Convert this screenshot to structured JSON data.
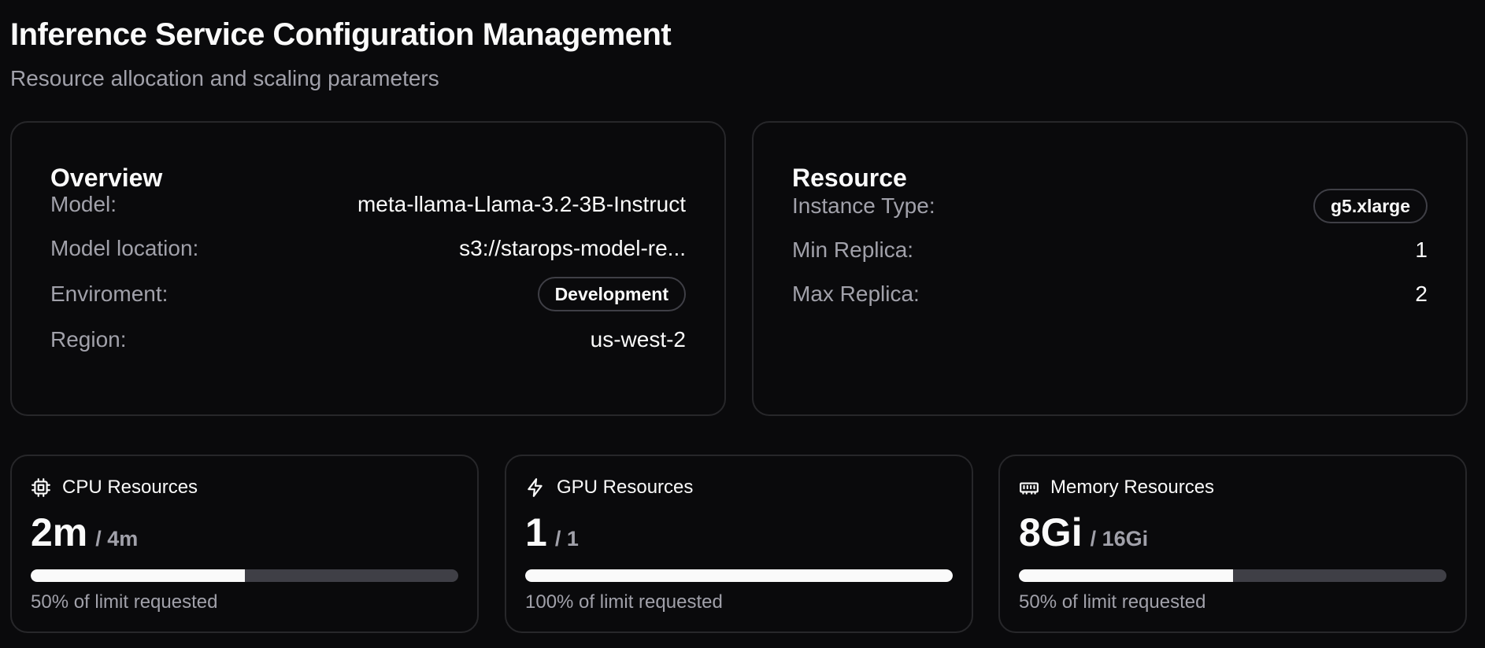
{
  "header": {
    "title": "Inference Service Configuration Management",
    "subtitle": "Resource allocation and scaling parameters"
  },
  "overview": {
    "title": "Overview",
    "rows": [
      {
        "label": "Model:",
        "value": "meta-llama-Llama-3.2-3B-Instruct"
      },
      {
        "label": "Model location:",
        "value": "s3://starops-model-re..."
      },
      {
        "label": "Enviroment:",
        "value": "Development"
      },
      {
        "label": "Region:",
        "value": "us-west-2"
      }
    ]
  },
  "resource": {
    "title": "Resource",
    "rows": [
      {
        "label": "Instance Type:",
        "value": "g5.xlarge"
      },
      {
        "label": "Min Replica:",
        "value": "1"
      },
      {
        "label": "Max Replica:",
        "value": "2"
      }
    ]
  },
  "stats": [
    {
      "label": "CPU Resources",
      "icon": "cpu-icon",
      "value": "2m",
      "limit": "/ 4m",
      "percent": 50,
      "note": "50% of limit requested"
    },
    {
      "label": "GPU Resources",
      "icon": "lightning-icon",
      "value": "1",
      "limit": "/ 1",
      "percent": 100,
      "note": "100% of limit requested"
    },
    {
      "label": "Memory Resources",
      "icon": "memory-icon",
      "value": "8Gi",
      "limit": "/ 16Gi",
      "percent": 50,
      "note": "50% of limit requested"
    }
  ],
  "colors": {
    "background": "#0a0a0c",
    "border": "#27272a",
    "muted_text": "#a1a1aa",
    "bar_track": "#3f3f46",
    "bar_fill": "#fafafa"
  }
}
